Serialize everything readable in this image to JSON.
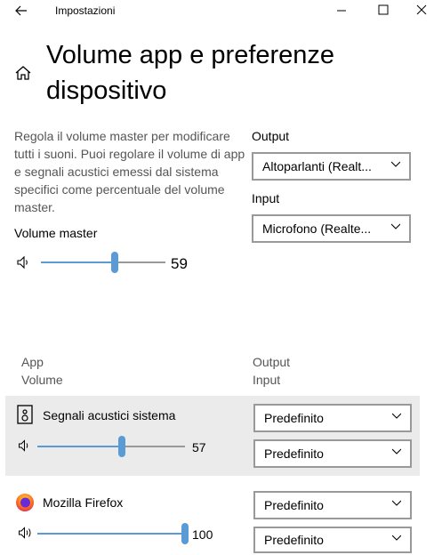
{
  "window": {
    "title": "Impostazioni"
  },
  "page": {
    "title": "Volume app e preferenze dispositivo"
  },
  "description": "Regola il volume master per modificare tutti i suoni. Puoi regolare il volume di app e segnali acustici emessi dal sistema specifici come percentuale del volume master.",
  "master": {
    "label": "Volume master",
    "value": "59",
    "level": 59
  },
  "output": {
    "label": "Output",
    "selected": "Altoparlanti (Realt..."
  },
  "input": {
    "label": "Input",
    "selected": "Microfono (Realte..."
  },
  "table": {
    "col1_line1": "App",
    "col1_line2": "Volume",
    "col2_line1": "Output",
    "col2_line2": "Input"
  },
  "apps": [
    {
      "name": "Segnali acustici sistema",
      "value": "57",
      "level": 57,
      "output": "Predefinito",
      "input": "Predefinito",
      "icon": "speaker-device-icon"
    },
    {
      "name": "Mozilla Firefox",
      "value": "100",
      "level": 100,
      "output": "Predefinito",
      "input": "Predefinito",
      "icon": "firefox-icon"
    }
  ],
  "colors": {
    "accent": "#5b9bd5",
    "selected_row": "#ebebeb"
  }
}
